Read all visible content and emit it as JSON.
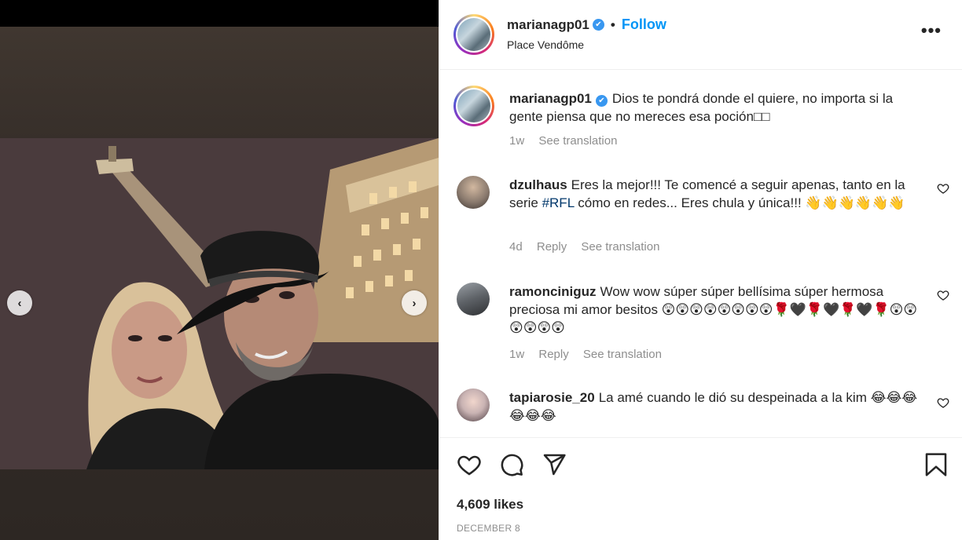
{
  "post": {
    "username": "marianagp01",
    "verified_mark": "✔",
    "follow_label": "Follow",
    "location": "Place Vendôme",
    "more_label": "•••"
  },
  "caption": {
    "username": "marianagp01",
    "text": "Dios te pondrá donde el quiere, no importa si la gente piensa que no mereces esa poción□□",
    "age": "1w",
    "see_translation": "See translation"
  },
  "comments": [
    {
      "username": "dzulhaus",
      "text_before": "Eres la mejor!!! Te comencé a seguir apenas, tanto en la serie ",
      "hashtag": "#RFL",
      "text_after": " cómo en redes... Eres chula y única!!! 👋👋👋👋👋👋",
      "age": "4d",
      "reply": "Reply",
      "see_translation": "See translation",
      "avatar_color": "#8a7a6e"
    },
    {
      "username": "ramonciniguz",
      "text": "Wow wow súper súper bellísima súper hermosa preciosa mi amor besitos 😲😲😲😲😲😲😲😲🌹🖤🌹🖤🌹🖤🌹😲😲😲😲😲😲",
      "age": "1w",
      "reply": "Reply",
      "see_translation": "See translation",
      "avatar_color": "#5d6166"
    },
    {
      "username": "tapiarosie_20",
      "text": "La amé cuando le dió su despeinada a la kim 😂😂😂😂😂😂",
      "avatar_color": "#c9b3b3"
    }
  ],
  "actions": {
    "like_icon": "heart-outline-icon",
    "comment_icon": "comment-bubble-icon",
    "share_icon": "paper-plane-icon",
    "save_icon": "bookmark-icon"
  },
  "likes": "4,609 likes",
  "date": "DECEMBER 8",
  "nav": {
    "prev": "‹",
    "next": "›"
  },
  "colors": {
    "link_blue": "#0095f6",
    "verified_blue": "#3897f0",
    "muted_gray": "#8e8e8e"
  }
}
